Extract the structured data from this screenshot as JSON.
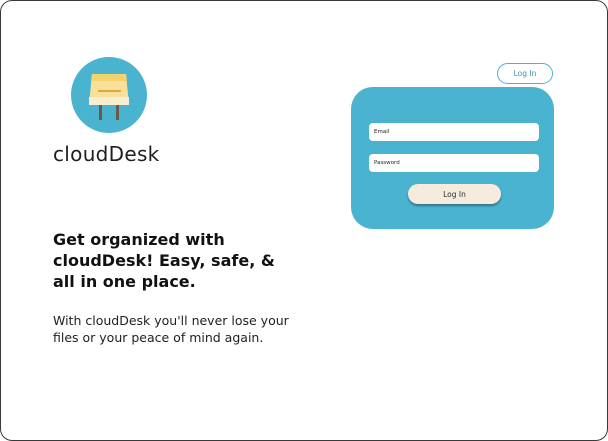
{
  "brand": {
    "name": "cloudDesk",
    "logo_icon": "desk-icon",
    "accent_color": "#4ab3d0"
  },
  "hero": {
    "headline": "Get organized with cloudDesk! Easy, safe, & all in one place.",
    "subtext": "With cloudDesk you'll never lose your files or your peace of mind again."
  },
  "header": {
    "login_label": "Log In"
  },
  "login_form": {
    "email_placeholder": "Email",
    "password_placeholder": "Password",
    "submit_label": "Log In",
    "card_color": "#4ab3d0",
    "button_color": "#f5ecde"
  }
}
